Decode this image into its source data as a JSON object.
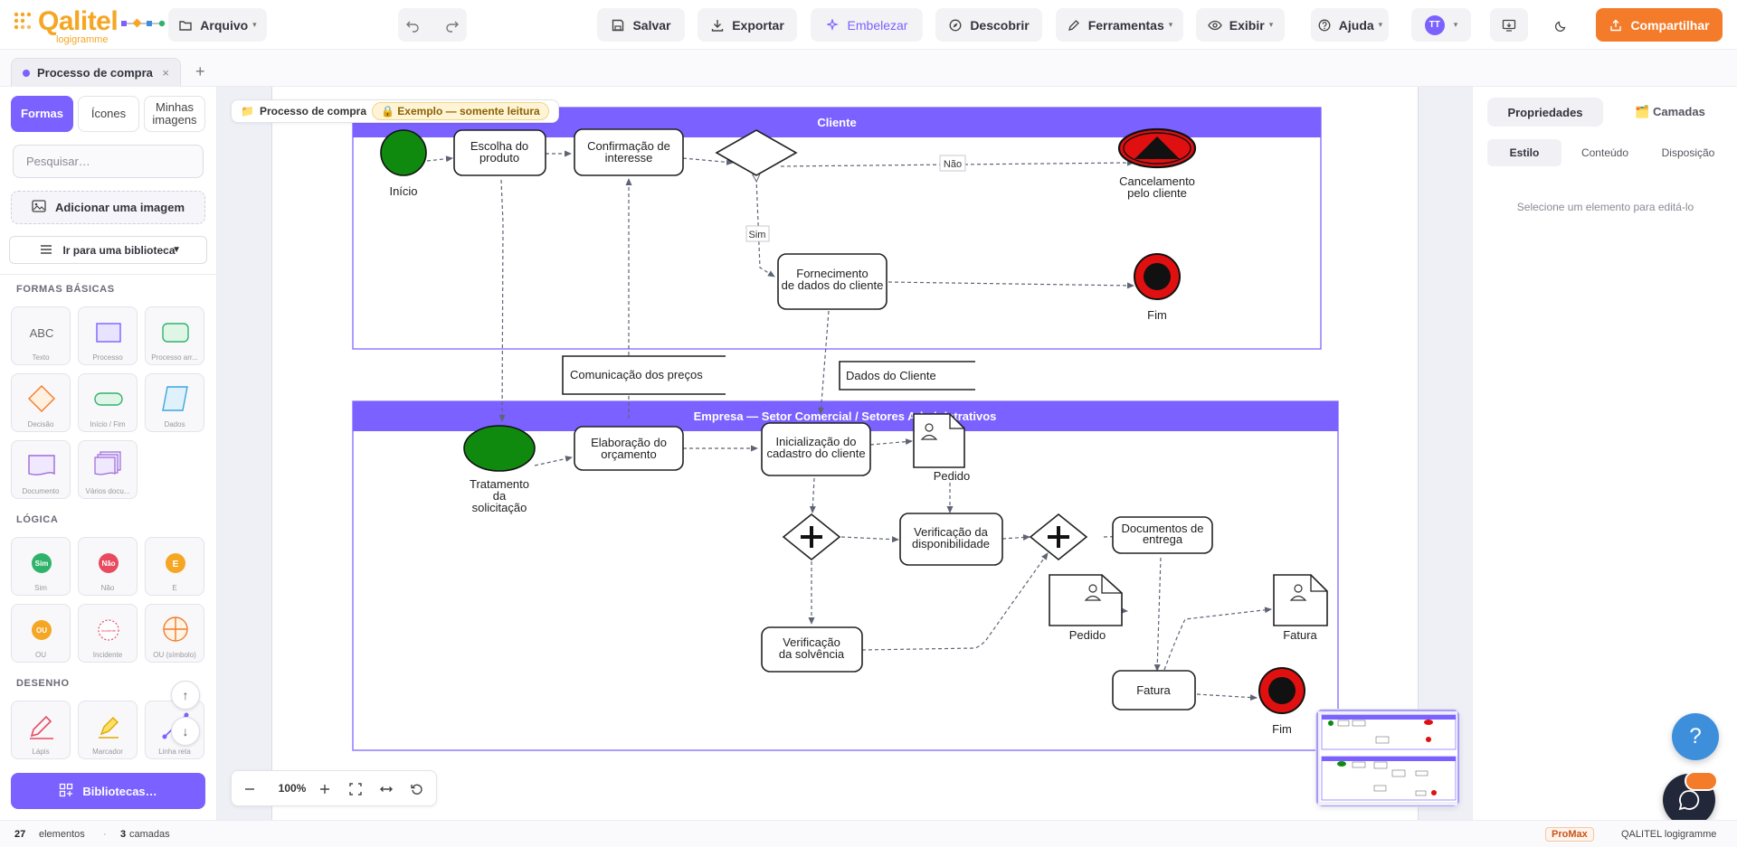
{
  "app": {
    "logo_name": "Qalitel",
    "logo_sub": "logigramme",
    "colors": {
      "accent": "#7b61ff",
      "brand": "#f5a623",
      "primary_action": "#f47b2a"
    }
  },
  "toolbar": {
    "file_label": "Arquivo",
    "save_label": "Salvar",
    "export_label": "Exportar",
    "beautify_label": "Embelezar",
    "discover_label": "Descobrir",
    "tools_label": "Ferramentas",
    "view_label": "Exibir",
    "help_label": "Ajuda",
    "avatar_initials": "TT",
    "share_label": "Compartilhar",
    "icons": [
      "folder-icon",
      "undo-icon",
      "redo-icon",
      "save-icon",
      "download-icon",
      "sparkle-icon",
      "compass-icon",
      "pen-icon",
      "eye-icon",
      "help-circle-icon",
      "present-icon",
      "moon-icon",
      "share-icon"
    ]
  },
  "tabs": {
    "active_label": "Processo de compra",
    "close_glyph": "×",
    "add_glyph": "+"
  },
  "sidebar": {
    "tabs": [
      {
        "label": "Formas",
        "active": true
      },
      {
        "label": "Ícones",
        "active": false
      },
      {
        "label": "Minhas imagens",
        "active": false
      }
    ],
    "search_placeholder": "Pesquisar…",
    "add_image_label": "Adicionar uma imagem",
    "goto_library_label": "Ir para uma biblioteca",
    "sections": {
      "basic": "FORMAS BÁSICAS",
      "logic": "LÓGICA",
      "drawing": "DESENHO"
    },
    "basic_shapes": [
      {
        "label": "Texto",
        "glyph": "ABC"
      },
      {
        "label": "Processo"
      },
      {
        "label": "Processo arr..."
      },
      {
        "label": "Decisão"
      },
      {
        "label": "Início / Fim"
      },
      {
        "label": "Dados"
      },
      {
        "label": "Documento"
      },
      {
        "label": "Vários docu..."
      }
    ],
    "logic_shapes": [
      {
        "label": "Sim",
        "glyph": "Sim"
      },
      {
        "label": "Não",
        "glyph": "Não"
      },
      {
        "label": "E",
        "glyph": "E"
      },
      {
        "label": "OU",
        "glyph": "OU"
      },
      {
        "label": "Incidente",
        "glyph": "Incidente"
      },
      {
        "label": "OU (símbolo)"
      }
    ],
    "drawing_shapes": [
      {
        "label": "Lápis"
      },
      {
        "label": "Marcador"
      },
      {
        "label": "Linha reta"
      }
    ],
    "scroll_up": "↑",
    "scroll_down": "↓",
    "libraries_label": "Bibliotecas…"
  },
  "canvas": {
    "breadcrumb_label": "Processo de compra",
    "readonly_label": "🔒 Exemplo — somente leitura",
    "zoom_level": "100%",
    "diagram": {
      "lane_top_title": "Cliente",
      "lane_bottom_title": "Empresa — Setor Comercial / Setores Administrativos",
      "labels": {
        "inicio": "Início",
        "escolha": [
          "Escolha do",
          "produto"
        ],
        "confirmacao": [
          "Confirmação de",
          "interesse"
        ],
        "nao": "Não",
        "sim": "Sim",
        "cancelamento": [
          "Cancelamento",
          "pelo cliente"
        ],
        "fornecimento": [
          "Fornecimento",
          "de dados do cliente"
        ],
        "fim_top": "Fim",
        "comunicacao": "Comunicação dos preços",
        "dados_cliente": "Dados do Cliente",
        "tratamento": [
          "Tratamento",
          "da",
          "solicitação"
        ],
        "elaboracao": [
          "Elaboração do",
          "orçamento"
        ],
        "inicializacao": [
          "Inicialização do",
          "cadastro do cliente"
        ],
        "pedido_1": "Pedido",
        "verificacao_disp": [
          "Verificação da",
          "disponibilidade"
        ],
        "documentos": [
          "Documentos de",
          "entrega"
        ],
        "pedido_2": "Pedido",
        "fatura_doc": "Fatura",
        "verificacao_solv": [
          "Verificação",
          "da solvência"
        ],
        "fatura_task": "Fatura",
        "fim_bottom": "Fim"
      }
    }
  },
  "right_panel": {
    "tabs": [
      {
        "label": "Propriedades",
        "active": true
      },
      {
        "label": "🗂️ Camadas",
        "active": false
      }
    ],
    "subtabs": [
      {
        "label": "Estilo",
        "active": true
      },
      {
        "label": "Conteúdo",
        "active": false
      },
      {
        "label": "Disposição",
        "active": false
      }
    ],
    "empty_message": "Selecione um elemento para editá-lo"
  },
  "help": {
    "glyph": "?"
  },
  "status": {
    "elements_count": "27",
    "elements_label": "elementos",
    "separator": "·",
    "layers_count": "3",
    "layers_label": "camadas",
    "plan_badge": "ProMax",
    "product_name": "QALITEL logigramme"
  }
}
